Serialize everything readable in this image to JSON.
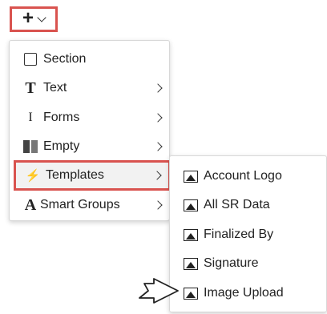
{
  "toolbar": {
    "add_button_icon": "plus-icon"
  },
  "main_menu": {
    "items": [
      {
        "label": "Section",
        "icon": "checkbox-icon",
        "has_submenu": false
      },
      {
        "label": "Text",
        "icon": "text-icon",
        "has_submenu": true
      },
      {
        "label": "Forms",
        "icon": "forms-icon",
        "has_submenu": true
      },
      {
        "label": "Empty",
        "icon": "empty-icon",
        "has_submenu": true
      },
      {
        "label": "Templates",
        "icon": "bolt-icon",
        "has_submenu": true,
        "highlighted": true
      },
      {
        "label": "Smart Groups",
        "icon": "smart-groups-icon",
        "has_submenu": true
      }
    ]
  },
  "sub_menu": {
    "items": [
      {
        "label": "Account Logo",
        "icon": "image-icon"
      },
      {
        "label": "All SR Data",
        "icon": "image-icon"
      },
      {
        "label": "Finalized By",
        "icon": "image-icon"
      },
      {
        "label": "Signature",
        "icon": "image-icon"
      },
      {
        "label": "Image Upload",
        "icon": "image-icon",
        "pointed": true
      }
    ]
  },
  "glyphs": {
    "text": "T",
    "forms": "I",
    "bolt": "⚡",
    "smart": "A"
  },
  "colors": {
    "highlight_border": "#d9534f"
  }
}
